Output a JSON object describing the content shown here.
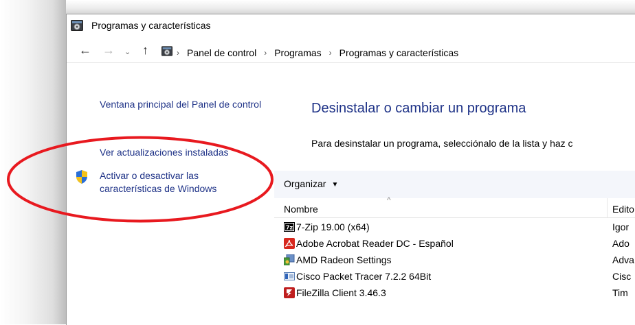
{
  "window": {
    "title": "Programas y características"
  },
  "address_bar": {
    "crumbs": [
      "Panel de control",
      "Programas",
      "Programas y características"
    ]
  },
  "sidebar": {
    "links": [
      "Ventana principal del Panel de control",
      "Ver actualizaciones instaladas",
      "Activar o desactivar las características de Windows"
    ]
  },
  "main": {
    "title": "Desinstalar o cambiar un programa",
    "description": "Para desinstalar un programa, selecciónalo de la lista y haz c",
    "toolbar": {
      "organize_label": "Organizar"
    },
    "columns": {
      "name": "Nombre",
      "publisher": "Edito"
    },
    "programs": [
      {
        "name": "7-Zip 19.00 (x64)",
        "publisher": "Igor",
        "icon": "7zip-icon"
      },
      {
        "name": "Adobe Acrobat Reader DC - Español",
        "publisher": "Ado",
        "icon": "acrobat-icon"
      },
      {
        "name": "AMD Radeon Settings",
        "publisher": "Adva",
        "icon": "amd-radeon-icon"
      },
      {
        "name": "Cisco Packet Tracer 7.2.2 64Bit",
        "publisher": "Cisc",
        "icon": "packet-tracer-icon"
      },
      {
        "name": "FileZilla Client 3.46.3",
        "publisher": "Tim",
        "icon": "filezilla-icon"
      }
    ]
  },
  "colors": {
    "link": "#1e3287",
    "highlight_ellipse": "#e8191f",
    "toolbar_bg": "#f4f6fb"
  }
}
